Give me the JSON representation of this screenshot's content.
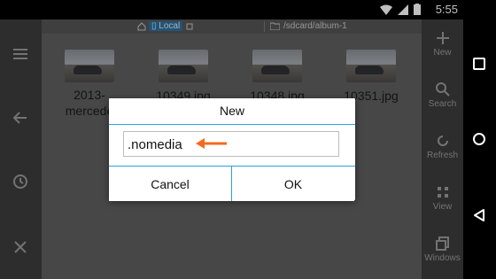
{
  "status_bar": {
    "time": "5:55"
  },
  "header": {
    "location_label": "Local",
    "path": "/sdcard/album-1"
  },
  "files": [
    {
      "name": "2013-\nmercede"
    },
    {
      "name": "10349.jpg"
    },
    {
      "name": "10348.jpg"
    },
    {
      "name": "10351.jpg"
    }
  ],
  "right_toolbar": {
    "new_label": "New",
    "search_label": "Search",
    "refresh_label": "Refresh",
    "view_label": "View",
    "windows_label": "Windows"
  },
  "dialog": {
    "title": "New",
    "input_value": ".nomedia",
    "cancel_label": "Cancel",
    "ok_label": "OK"
  },
  "colors": {
    "accent": "#2aa3d8",
    "arrow": "#f26b21",
    "chip": "#2e6fa1"
  }
}
